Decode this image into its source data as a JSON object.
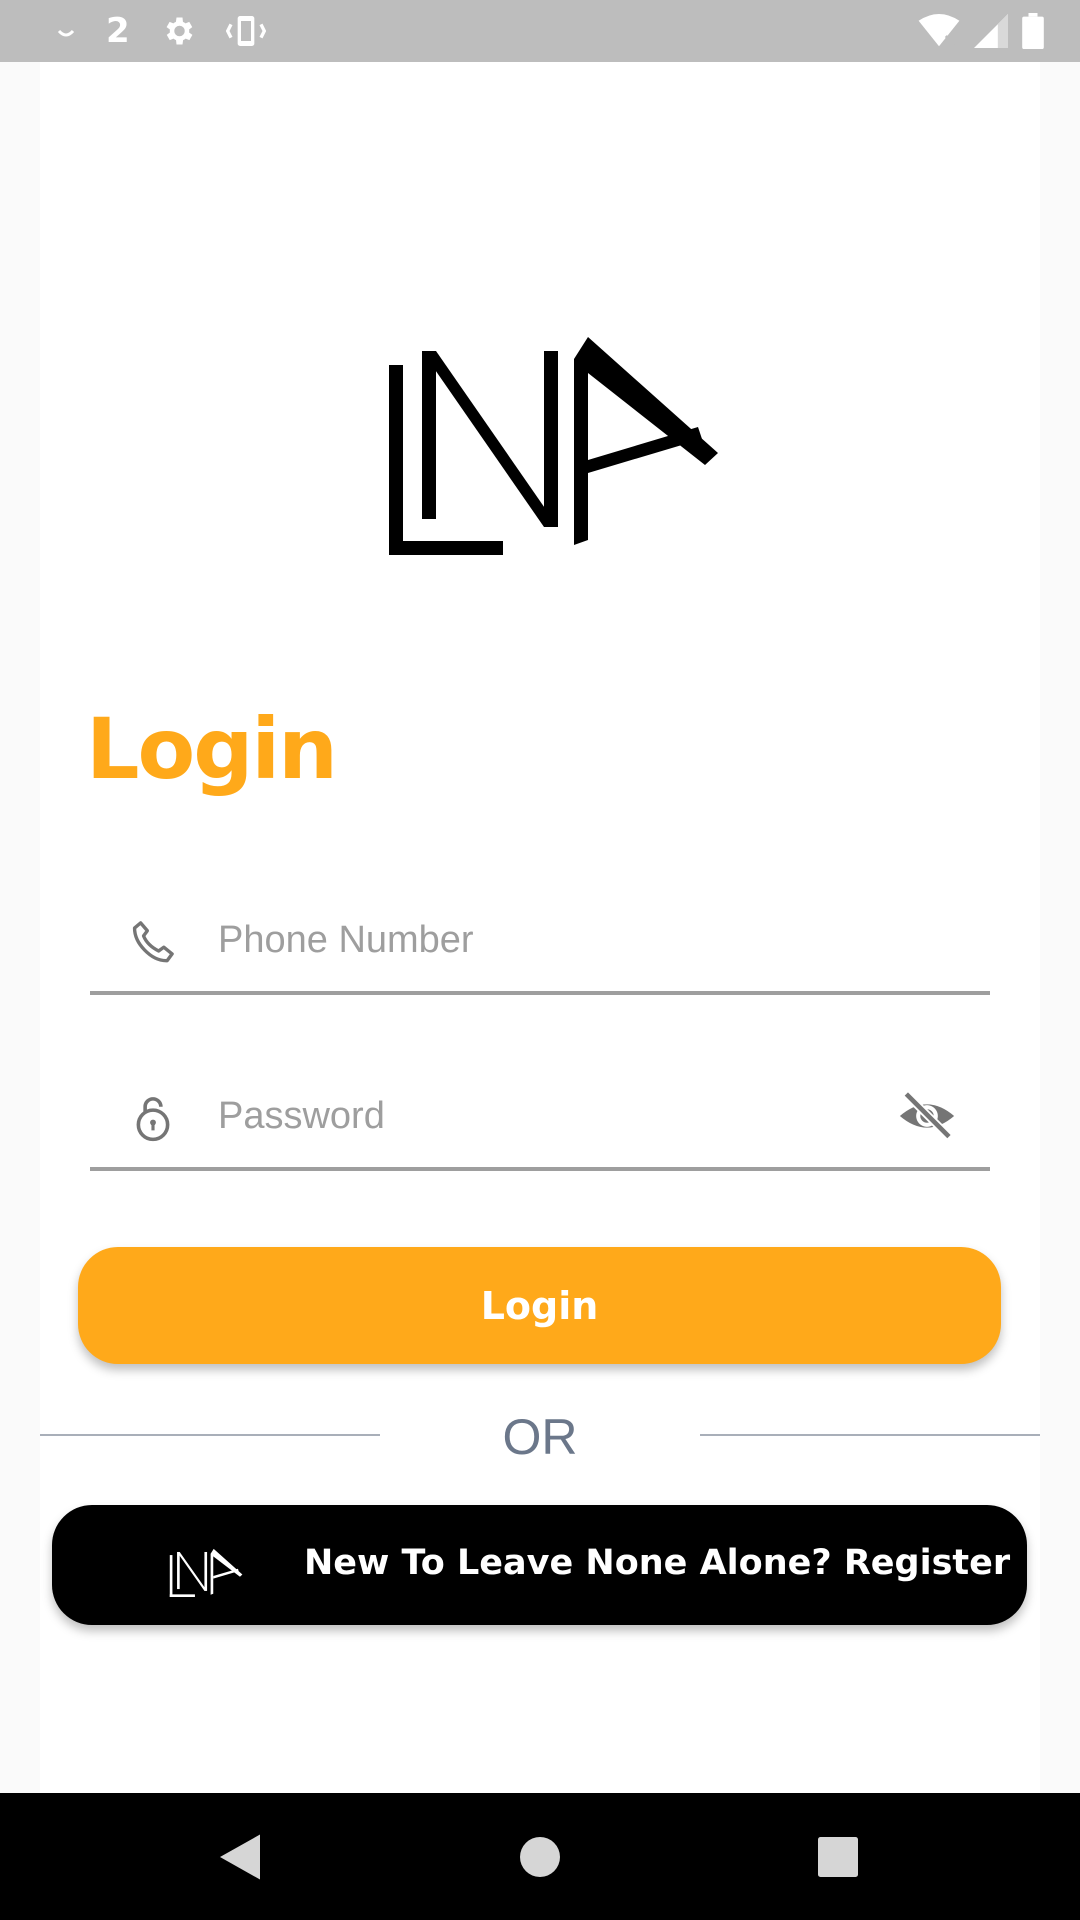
{
  "status_bar": {
    "notification_count": "2",
    "icons": [
      "download-icon",
      "gear-icon",
      "vibrate-icon",
      "wifi-icon",
      "signal-icon",
      "battery-icon"
    ]
  },
  "logo": {
    "text": "LNA"
  },
  "login": {
    "title": "Login",
    "phone_placeholder": "Phone Number",
    "phone_value": "",
    "password_placeholder": "Password",
    "password_value": "",
    "button_label": "Login"
  },
  "divider": {
    "text": "OR"
  },
  "register": {
    "label": "New To Leave None Alone? Register"
  },
  "colors": {
    "accent": "#ffa91a",
    "status_bar": "#bdbdbd",
    "register_button": "#000000",
    "nav_bar": "#000000"
  },
  "nav": {
    "icons": [
      "back-icon",
      "home-icon",
      "recents-icon"
    ]
  }
}
